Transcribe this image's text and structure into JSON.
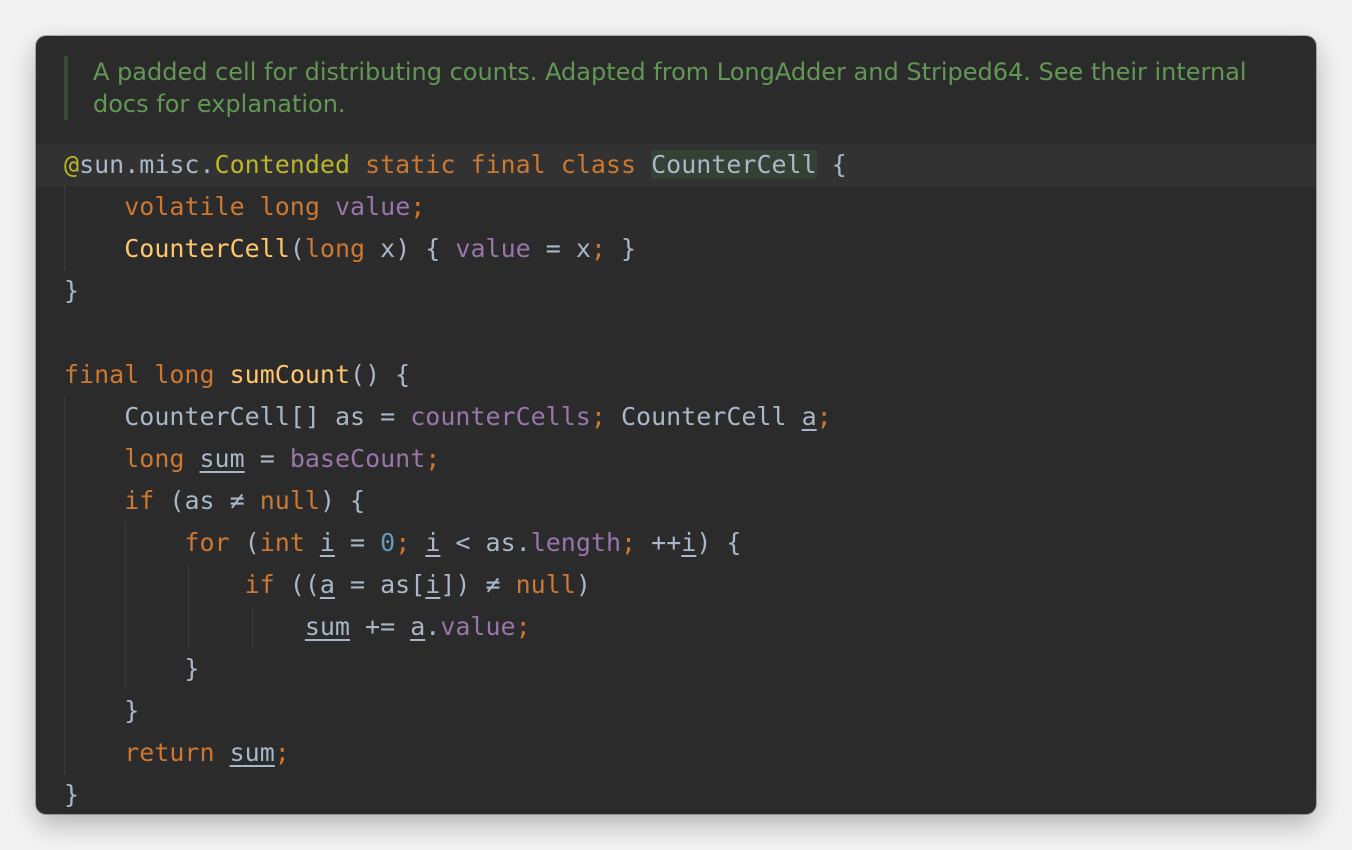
{
  "doc_comment": {
    "line1": "A padded cell for distributing counts. Adapted from LongAdder and Striped64. See their internal",
    "line2": "docs for explanation."
  },
  "code": {
    "at": "@",
    "ann_prefix": "sun.misc.",
    "ann_name": "Contended",
    "kw_static": "static",
    "kw_final": "final",
    "kw_class": "class",
    "class_name": "CounterCell",
    "kw_volatile": "volatile",
    "kw_long": "long",
    "kw_int": "int",
    "kw_if": "if",
    "kw_for": "for",
    "kw_return": "return",
    "kw_null": "null",
    "field_value": "value",
    "field_counterCells": "counterCells",
    "field_baseCount": "baseCount",
    "field_length": "length",
    "method_sumCount": "sumCount",
    "ctor_name": "CounterCell",
    "type_array": "CounterCell[]",
    "type_name": "CounterCell",
    "var_x": "x",
    "var_as": "as",
    "var_a": "a",
    "var_sum": "sum",
    "var_i": "i",
    "num_zero": "0",
    "op_ne": "≠",
    "op_inc": "++"
  }
}
